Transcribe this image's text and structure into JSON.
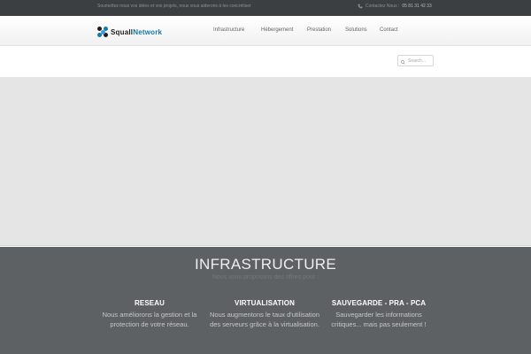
{
  "topbar": {
    "tagline": "Soumettez nous vos idées et vos projets, nous vous aiderons à les concrétiser",
    "contact_label": "Contactez Nous :",
    "contact_phone": "05 81 31 42 33",
    "phone_icon": "phone-icon"
  },
  "header": {
    "logo_part1": "Squall",
    "logo_part2": "Network",
    "nav": [
      "Infrastructure",
      "Hébergement",
      "Prestation",
      "Solutions",
      "Contact"
    ]
  },
  "search": {
    "placeholder": "Search..."
  },
  "section": {
    "title": "INFRASTRUCTURE",
    "subtitle": "Nous vous proposons des offres pour :",
    "columns": [
      {
        "title": "RESEAU",
        "text": "Nous améliorons la gestion et la protection de votre réseau."
      },
      {
        "title": "VIRTUALISATION",
        "text": "Nous augmentons le taux d'utilisation des serveurs grâce à la virtualisation."
      },
      {
        "title": "SAUVEGARDE - PRA - PCA",
        "text": "Sauvegarder les informations critiques... mais pas seulement !"
      }
    ]
  },
  "colors": {
    "topbar": "#3c3f42",
    "accent": "#167aa8",
    "section_bg": "#5e6164"
  }
}
